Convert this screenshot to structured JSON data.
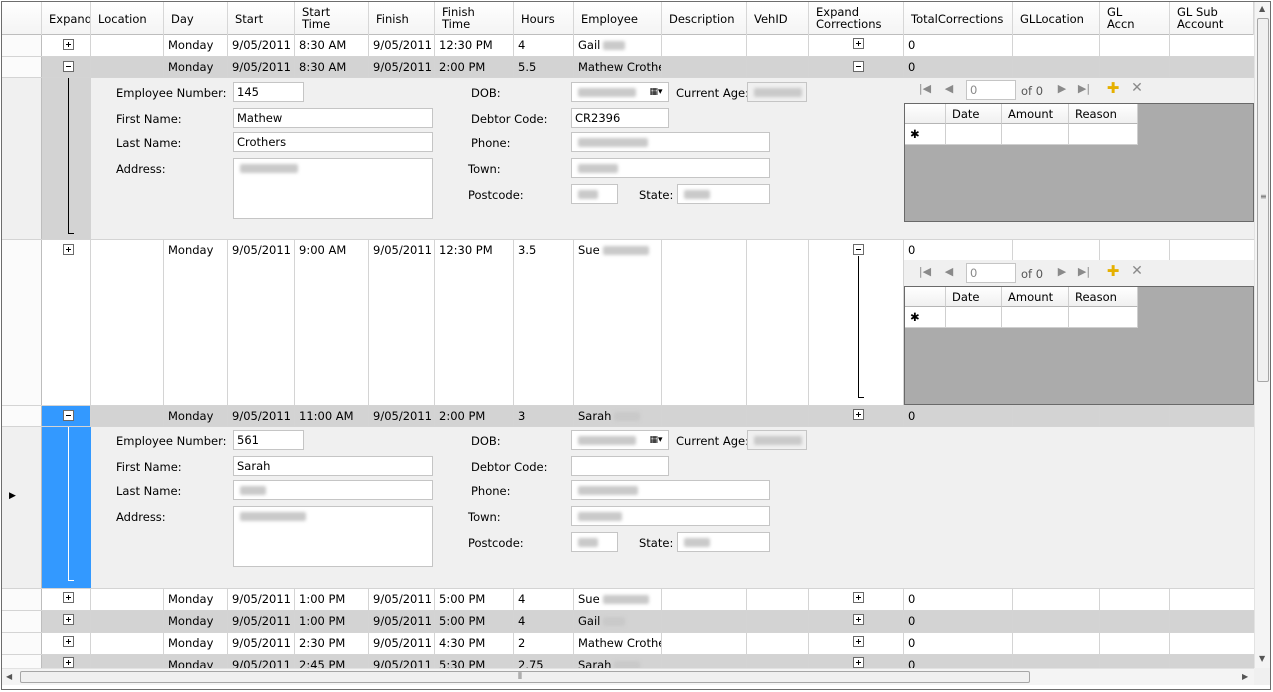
{
  "columns": [
    {
      "key": "expand",
      "label": "Expand"
    },
    {
      "key": "location",
      "label": "Location"
    },
    {
      "key": "day",
      "label": "Day"
    },
    {
      "key": "start",
      "label": "Start"
    },
    {
      "key": "start_time",
      "label": "Start\nTime"
    },
    {
      "key": "finish",
      "label": "Finish"
    },
    {
      "key": "finish_time",
      "label": "Finish\nTime"
    },
    {
      "key": "hours",
      "label": "Hours"
    },
    {
      "key": "employee",
      "label": "Employee"
    },
    {
      "key": "description",
      "label": "Description"
    },
    {
      "key": "vehid",
      "label": "VehID"
    },
    {
      "key": "expand_corrections",
      "label": "Expand\nCorrections"
    },
    {
      "key": "total_corrections",
      "label": "TotalCorrections"
    },
    {
      "key": "gl_location",
      "label": "GLLocation"
    },
    {
      "key": "gl_accn",
      "label": "GL\nAccn"
    },
    {
      "key": "gl_sub_account",
      "label": "GL Sub\nAccount"
    }
  ],
  "rows": [
    {
      "day": "Monday",
      "start": "9/05/2011",
      "start_time": "8:30 AM",
      "finish": "9/05/2011",
      "finish_time": "12:30 PM",
      "hours": "4",
      "employee_first": "Gail",
      "total": "0"
    },
    {
      "day": "Monday",
      "start": "9/05/2011",
      "start_time": "8:30 AM",
      "finish": "9/05/2011",
      "finish_time": "2:00 PM",
      "hours": "5.5",
      "employee_first": "Mathew Crothers",
      "total": "0"
    },
    {
      "day": "Monday",
      "start": "9/05/2011",
      "start_time": "9:00 AM",
      "finish": "9/05/2011",
      "finish_time": "12:30 PM",
      "hours": "3.5",
      "employee_first": "Sue",
      "total": "0"
    },
    {
      "day": "Monday",
      "start": "9/05/2011",
      "start_time": "11:00 AM",
      "finish": "9/05/2011",
      "finish_time": "2:00 PM",
      "hours": "3",
      "employee_first": "Sarah",
      "total": "0"
    },
    {
      "day": "Monday",
      "start": "9/05/2011",
      "start_time": "1:00 PM",
      "finish": "9/05/2011",
      "finish_time": "5:00 PM",
      "hours": "4",
      "employee_first": "Sue",
      "total": "0"
    },
    {
      "day": "Monday",
      "start": "9/05/2011",
      "start_time": "1:00 PM",
      "finish": "9/05/2011",
      "finish_time": "5:00 PM",
      "hours": "4",
      "employee_first": "Gail",
      "total": "0"
    },
    {
      "day": "Monday",
      "start": "9/05/2011",
      "start_time": "2:30 PM",
      "finish": "9/05/2011",
      "finish_time": "4:30 PM",
      "hours": "2",
      "employee_first": "Mathew Crothers",
      "total": "0"
    },
    {
      "day": "Monday",
      "start": "9/05/2011",
      "start_time": "2:45 PM",
      "finish": "9/05/2011",
      "finish_time": "5:30 PM",
      "hours": "2.75",
      "employee_first": "Sarah",
      "total": "0"
    }
  ],
  "detail_labels": {
    "employee_number": "Employee Number:",
    "first_name": "First Name:",
    "last_name": "Last Name:",
    "address": "Address:",
    "dob": "DOB:",
    "current_age": "Current Age:",
    "debtor_code": "Debtor Code:",
    "phone": "Phone:",
    "town": "Town:",
    "postcode": "Postcode:",
    "state": "State:"
  },
  "detail1": {
    "employee_number": "145",
    "first_name": "Mathew",
    "last_name": "Crothers",
    "debtor_code": "CR2396"
  },
  "detail2": {
    "employee_number": "561",
    "first_name": "Sarah",
    "last_name": "",
    "debtor_code": ""
  },
  "corrections": {
    "position": "0",
    "of_label": "of 0",
    "headers": [
      "Date",
      "Amount",
      "Reason"
    ],
    "new_row_marker": "✱"
  },
  "icons": {
    "first": "first-record-icon",
    "prev": "prev-record-icon",
    "next": "next-record-icon",
    "last": "last-record-icon",
    "add": "add-icon",
    "delete": "delete-icon",
    "row_pointer": "current-row-arrow-icon"
  },
  "colors": {
    "selected_expand": "#3399ff",
    "alt_row": "#d3d3d3",
    "sub_bg": "#ababab",
    "add_icon": "#e5b000"
  }
}
